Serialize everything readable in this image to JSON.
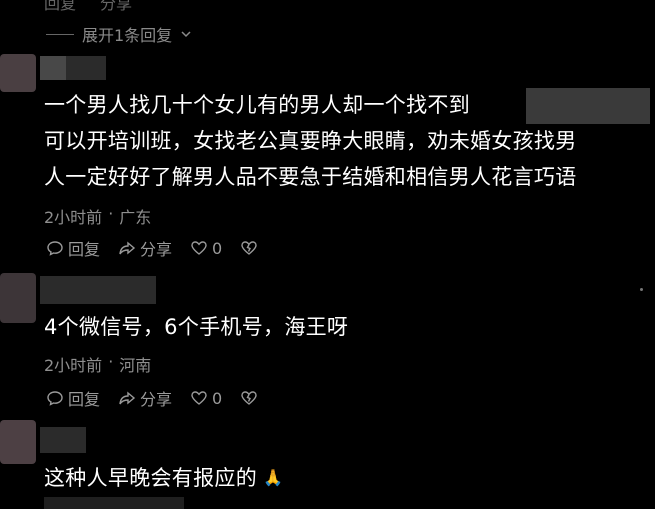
{
  "top_partial": {
    "reply_label": "回复",
    "share_label": "分享",
    "expand_replies": "展开1条回复"
  },
  "comments": [
    {
      "text_lines": [
        "一个男人找几十个女儿有的男人却一个找不到",
        "可以开培训班，女找老公真要睁大眼睛，劝未婚女孩找男",
        "人一定好好了解男人品不要急于结婚和相信男人花言巧语"
      ],
      "time": "2小时前",
      "location": "广东",
      "reply_label": "回复",
      "share_label": "分享",
      "likes": "0"
    },
    {
      "text_lines": [
        "4个微信号，6个手机号，海王呀"
      ],
      "time": "2小时前",
      "location": "河南",
      "reply_label": "回复",
      "share_label": "分享",
      "likes": "0"
    },
    {
      "text_lines": [
        "这种人早晚会有报应的"
      ],
      "emoji": "🙏",
      "time": "",
      "location": ""
    }
  ],
  "separator": "·",
  "colors": {
    "background": "#000000",
    "text": "#ffffff",
    "meta": "#8f8f8f",
    "avatar": "#4a3f42"
  },
  "icons": [
    "reply-icon",
    "share-icon",
    "like-icon",
    "dislike-icon",
    "chevron-down-icon",
    "more-icon"
  ]
}
